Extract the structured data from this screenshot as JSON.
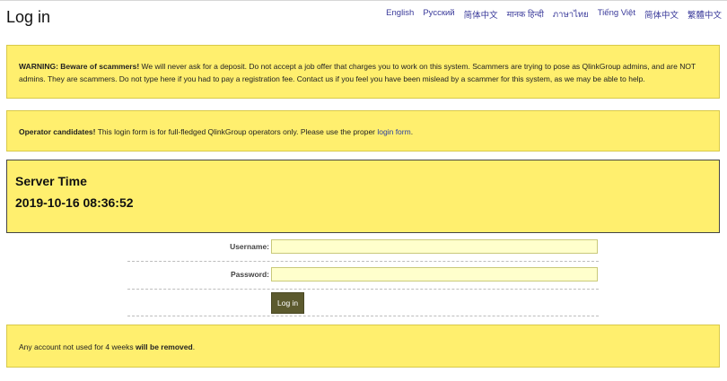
{
  "page": {
    "title": "Log in"
  },
  "languages": [
    "English",
    "Русский",
    "简体中文",
    "मानक हिन्दी",
    "ภาษาไทย",
    "Tiếng Việt",
    "简体中文",
    "繁體中文"
  ],
  "warning": {
    "heading": "WARNING: Beware of scammers!",
    "text": " We will never ask for a deposit. Do not accept a job offer that charges you to work on this system. Scammers are trying to pose as QlinkGroup admins, and are NOT admins. They are scammers. Do not type here if you had to pay a registration fee. Contact us if you feel you have been mislead by a scammer for this system, as we may be able to help."
  },
  "operator": {
    "heading": "Operator candidates!",
    "text": " This login form is for full-fledged QlinkGroup operators only. Please use the proper ",
    "link_label": "login form",
    "text_end": "."
  },
  "server_time": {
    "title": "Server Time",
    "value": "2019-10-16 08:36:52"
  },
  "form": {
    "username_label": "Username:",
    "username_value": "",
    "password_label": "Password:",
    "password_value": "",
    "submit_label": "Log in"
  },
  "notice": {
    "text": "Any account not used for 4 weeks ",
    "emphasis": "will be removed",
    "text_end": "."
  },
  "colors": {
    "box_background": "#ffef6e",
    "button_background": "#5c5a2e",
    "input_background": "#ffffcc",
    "link": "#3a3a9a"
  }
}
